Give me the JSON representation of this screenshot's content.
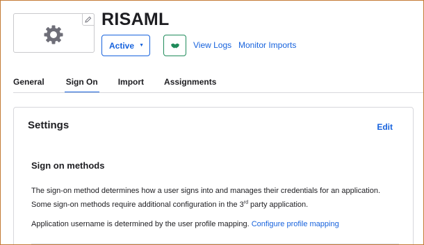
{
  "app": {
    "title": "RISAML",
    "status_label": "Active",
    "view_logs": "View Logs",
    "monitor_imports": "Monitor Imports"
  },
  "tabs": [
    {
      "label": "General",
      "active": false
    },
    {
      "label": "Sign On",
      "active": true
    },
    {
      "label": "Import",
      "active": false
    },
    {
      "label": "Assignments",
      "active": false
    }
  ],
  "settings": {
    "title": "Settings",
    "edit_label": "Edit",
    "sign_on_methods": {
      "title": "Sign on methods",
      "description_part1": "The sign-on method determines how a user signs into and manages their credentials for an application. Some sign-on methods require additional configuration in the 3",
      "description_sup": "rd",
      "description_part2": " party application.",
      "username_text": "Application username is determined by the user profile mapping. ",
      "configure_link": "Configure profile mapping"
    }
  },
  "colors": {
    "accent": "#1662dd",
    "success": "#1f8b5a",
    "border": "#d7d7dc",
    "frame": "#c47a35"
  },
  "icons": {
    "app_logo": "gear-icon",
    "edit_logo": "pencil-icon",
    "status_dropdown": "caret-down-icon",
    "push": "handshake-icon"
  }
}
